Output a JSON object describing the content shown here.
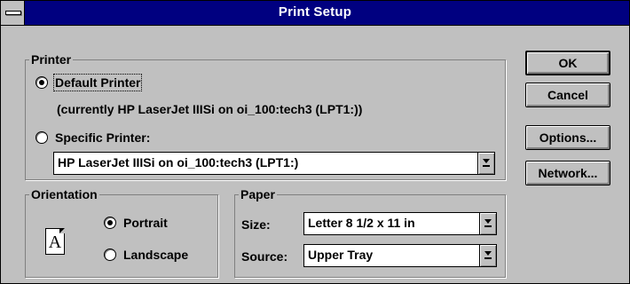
{
  "window": {
    "title": "Print Setup"
  },
  "printer": {
    "label": "Printer",
    "default_option": "Default Printer",
    "current_printer_note": "(currently HP LaserJet IIISi on oi_100:tech3 (LPT1:))",
    "specific_option": "Specific Printer:",
    "specific_value": "HP LaserJet IIISi on oi_100:tech3 (LPT1:)",
    "selected": "default"
  },
  "orientation": {
    "label": "Orientation",
    "page_glyph": "A",
    "portrait": "Portrait",
    "landscape": "Landscape",
    "selected": "portrait"
  },
  "paper": {
    "label": "Paper",
    "size_label": "Size:",
    "size_value": "Letter 8 1/2 x 11 in",
    "source_label": "Source:",
    "source_value": "Upper Tray"
  },
  "buttons": {
    "ok": "OK",
    "cancel": "Cancel",
    "options": "Options...",
    "network": "Network..."
  },
  "icons": {
    "system_menu": "system-menu-icon",
    "dropdown": "dropdown-arrow-icon",
    "orientation_page": "portrait-page-icon"
  },
  "colors": {
    "title_bar": "#000080",
    "face": "#c0c0c0",
    "shadow": "#808080"
  }
}
